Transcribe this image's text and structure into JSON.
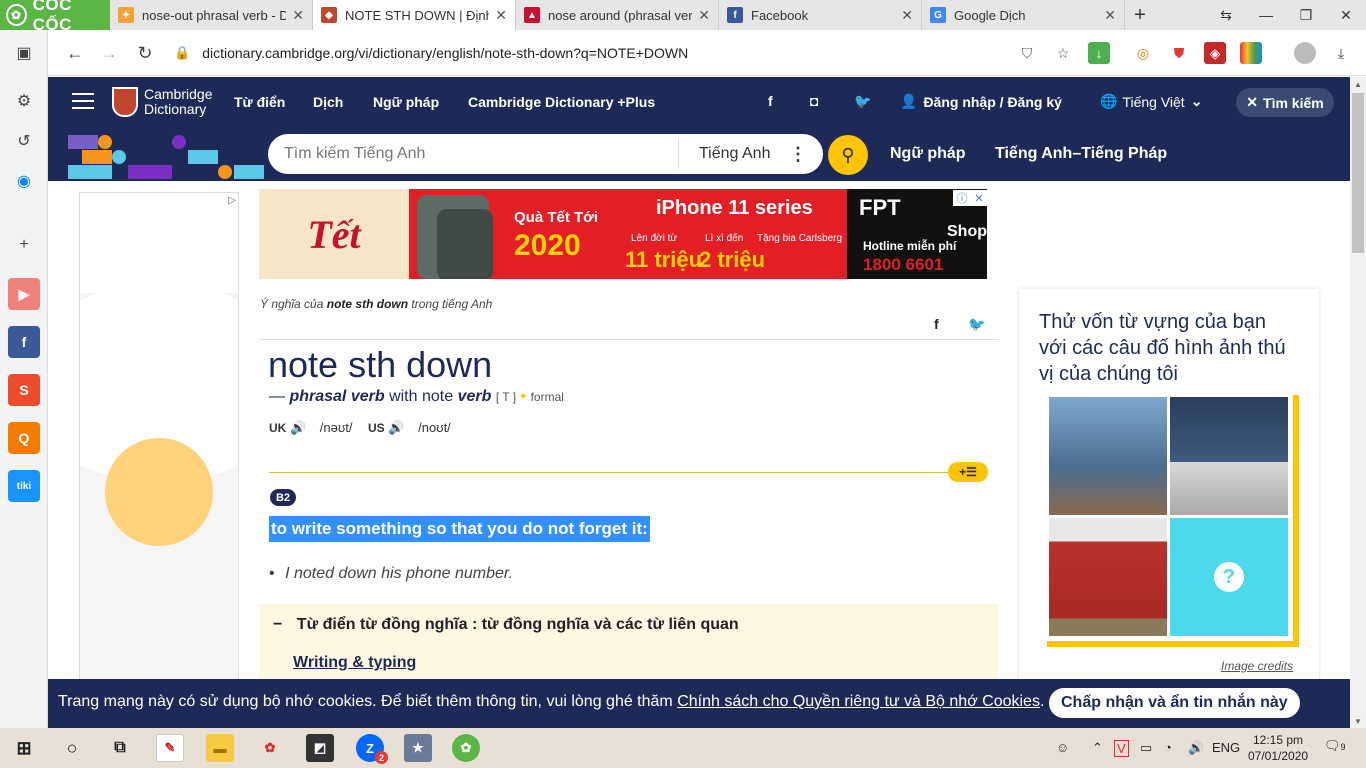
{
  "browser": {
    "brand": "CỐC CỐC",
    "tabs": [
      {
        "title": "nose-out phrasal verb - Def",
        "color": "#f2a23a",
        "active": false
      },
      {
        "title": "NOTE STH DOWN | Định ng",
        "color": "#c2452d",
        "active": true
      },
      {
        "title": "nose around (phrasal verb)",
        "color": "#c8102e",
        "active": false
      },
      {
        "title": "Facebook",
        "color": "#3b5998",
        "active": false
      },
      {
        "title": "Google Dịch",
        "color": "#4285f4",
        "active": false
      }
    ],
    "url": "dictionary.cambridge.org/vi/dictionary/english/note-sth-down?q=NOTE+DOWN"
  },
  "header": {
    "logo_line1": "Cambridge",
    "logo_line2": "Dictionary",
    "nav": [
      "Từ điển",
      "Dịch",
      "Ngữ pháp",
      "Cambridge Dictionary +Plus"
    ],
    "login": "Đăng nhập / Đăng ký",
    "language": "Tiếng Việt",
    "search_button": "Tìm kiếm"
  },
  "search": {
    "placeholder": "Tìm kiếm Tiếng Anh",
    "language": "Tiếng Anh",
    "links": [
      "Ngữ pháp",
      "Tiếng Anh–Tiếng Pháp"
    ]
  },
  "ad": {
    "tet": "Tết",
    "promo": "Quà Tết Tới",
    "year": "2020",
    "product": "iPhone 11 series",
    "deal1_label": "Lên đời từ",
    "deal1_value": "11 triệu",
    "deal2_label": "Lì xì đến",
    "deal2_value": "2 triệu",
    "deal3_label": "Tặng bia Carlsberg",
    "fpt": "FPT",
    "shop": "Shop",
    "hotline": "Hotline miễn phí",
    "phone": "1800 6601"
  },
  "entry": {
    "meaning_prefix": "Ý nghĩa của",
    "meaning_word": "note sth down",
    "meaning_suffix": "trong tiếng Anh",
    "headword": "note sth down",
    "pos_dash": "—",
    "pos": "phrasal verb",
    "with_note": "with note",
    "verb": "verb",
    "grammar": "[ T ]",
    "register": "formal",
    "uk_label": "UK",
    "uk_ipa": "/nəʊt/",
    "us_label": "US",
    "us_ipa": "/noʊt/",
    "level": "B2",
    "definition": "to write something so that you do not forget it:",
    "example": "I noted down his phone number.",
    "thesaurus_heading": "Từ điển từ đồng nghĩa : từ đồng nghĩa và các từ liên quan",
    "thesaurus_link": "Writing & typing"
  },
  "quiz": {
    "question": "Thử vốn từ vựng của bạn với các câu đố hình ảnh thú vị của chúng tôi",
    "credits": "Image credits"
  },
  "cookie": {
    "message": "Trang mạng này có sử dụng bộ nhớ cookies. Để biết thêm thông tin, vui lòng ghé thăm",
    "link": "Chính sách cho Quyền riêng tư và Bộ nhớ Cookies",
    "period": ".",
    "accept": "Chấp nhận và ẩn tin nhắn này"
  },
  "taskbar": {
    "lang": "ENG",
    "time": "12:15 pm",
    "date": "07/01/2020",
    "notifications": "9",
    "zalo_badge": "2"
  }
}
